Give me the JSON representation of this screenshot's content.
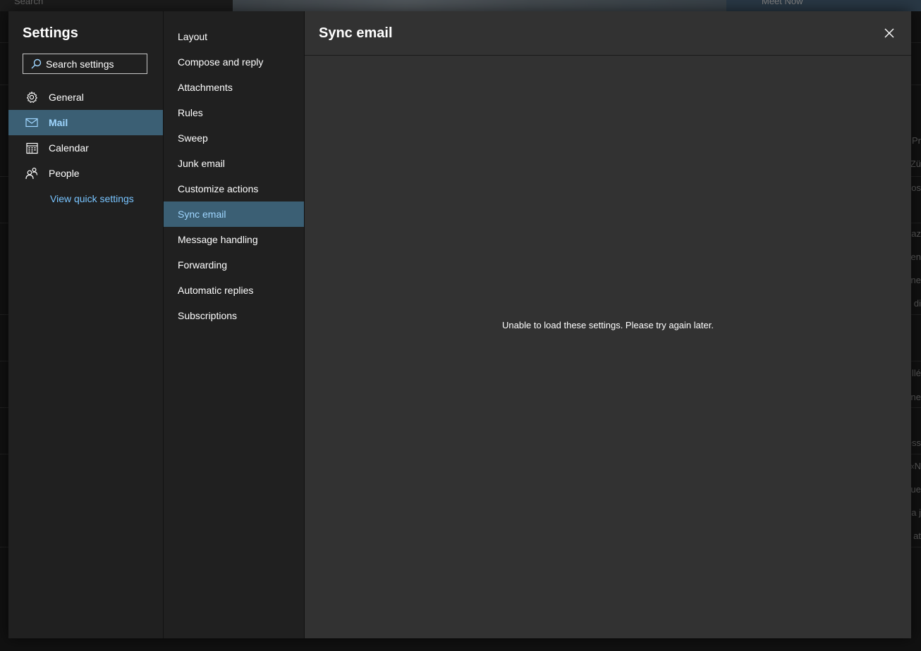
{
  "background": {
    "search_label": "Search",
    "meet_now_label": "Meet Now",
    "right_fragments": [
      "Pr",
      "Zü",
      "os",
      "az",
      "en",
      "ne",
      "di",
      "llé",
      "ne",
      "éss",
      "«N",
      "ue",
      "a j",
      "at"
    ]
  },
  "nav": {
    "title": "Settings",
    "search_placeholder": "Search settings",
    "items": [
      {
        "label": "General",
        "icon": "gear-icon"
      },
      {
        "label": "Mail",
        "icon": "mail-icon"
      },
      {
        "label": "Calendar",
        "icon": "calendar-icon"
      },
      {
        "label": "People",
        "icon": "people-icon"
      }
    ],
    "active_item": "Mail",
    "quick_settings_link": "View quick settings"
  },
  "submenu": {
    "items": [
      "Layout",
      "Compose and reply",
      "Attachments",
      "Rules",
      "Sweep",
      "Junk email",
      "Customize actions",
      "Sync email",
      "Message handling",
      "Forwarding",
      "Automatic replies",
      "Subscriptions"
    ],
    "active_item": "Sync email"
  },
  "main": {
    "title": "Sync email",
    "error_message": "Unable to load these settings. Please try again later."
  },
  "colors": {
    "active_bg": "#3b5f74",
    "active_text": "#9fd6ff",
    "link": "#78c4ff",
    "panel_bg": "#202020",
    "content_bg": "#323232"
  }
}
